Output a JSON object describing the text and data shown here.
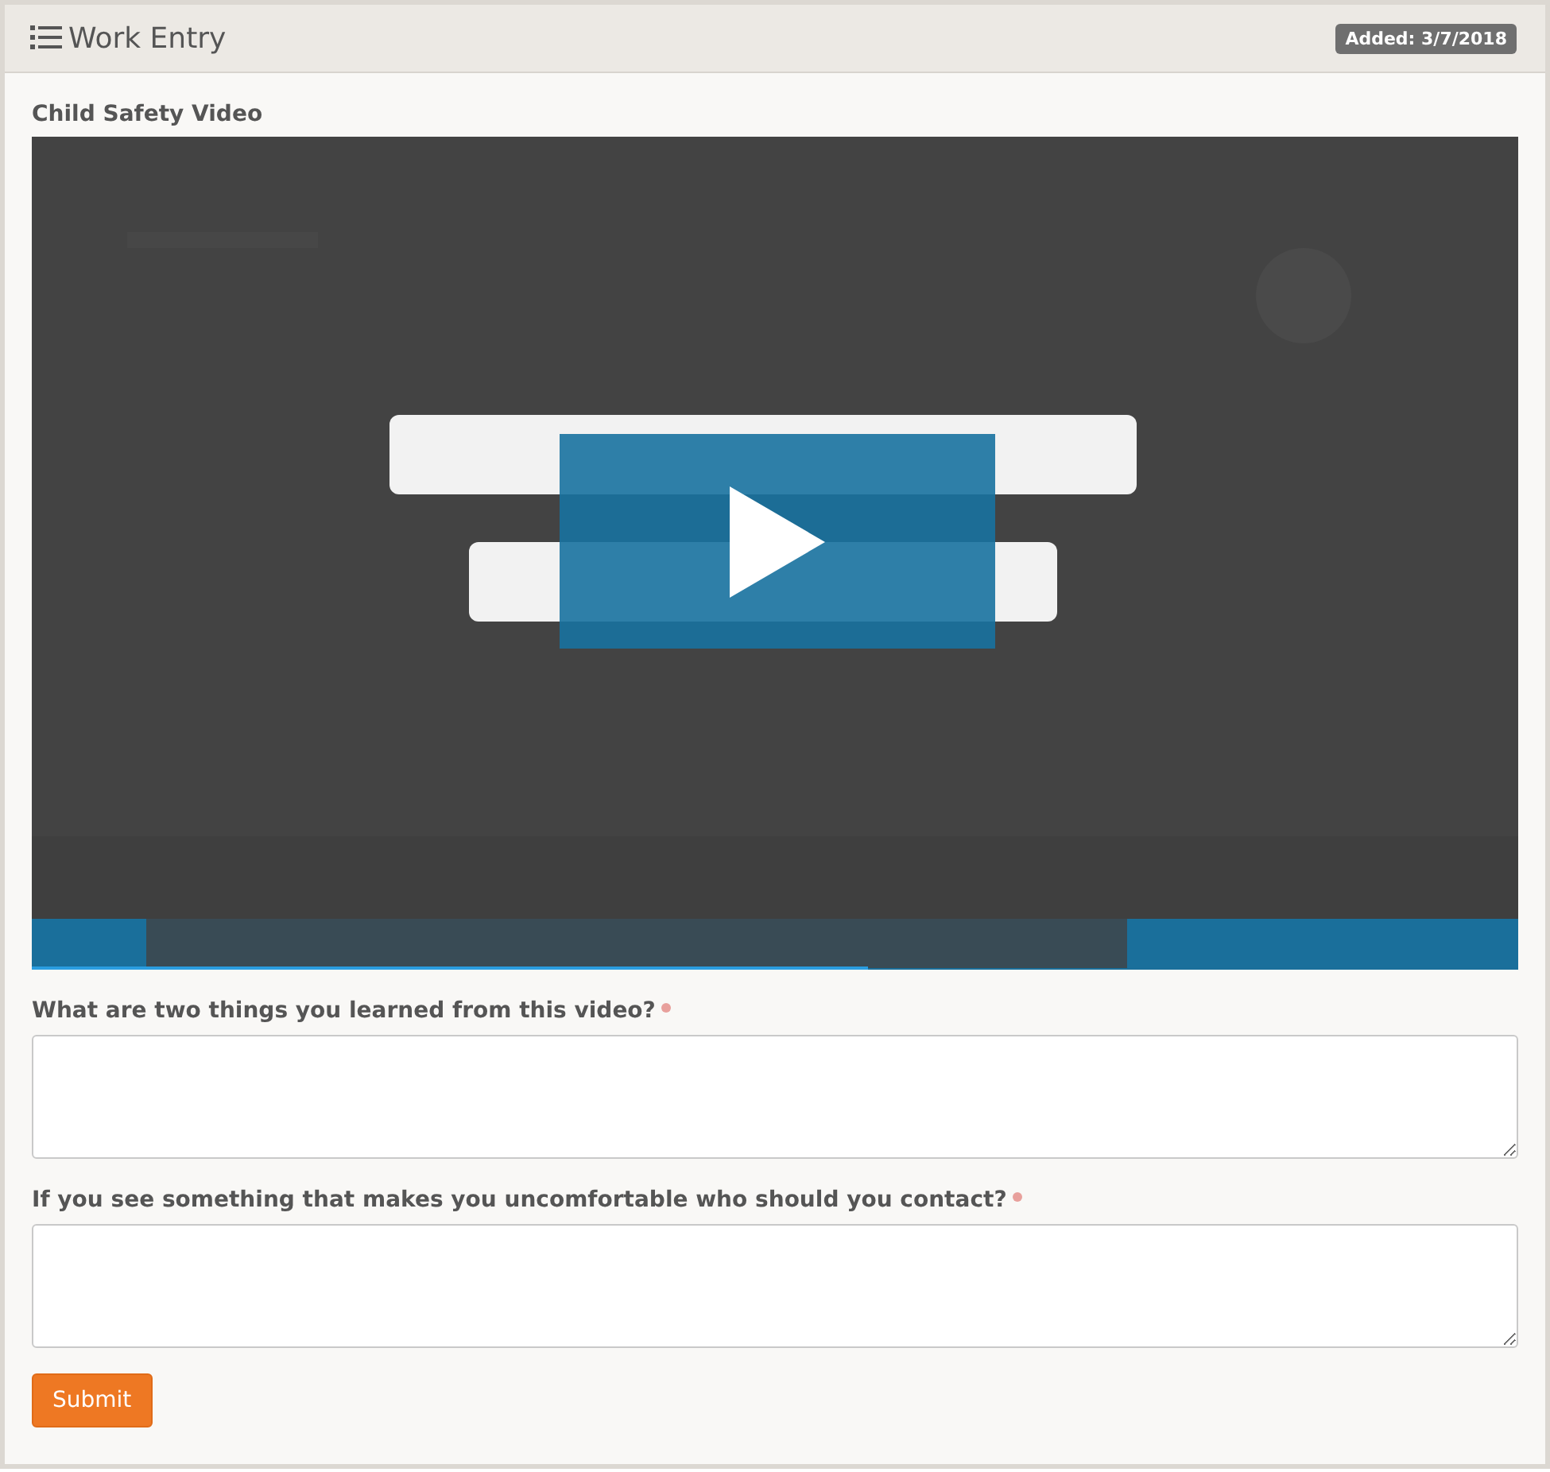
{
  "panel": {
    "title": "Work Entry",
    "badge": "Added: 3/7/2018"
  },
  "video": {
    "label": "Child Safety Video",
    "kind": "picture"
  },
  "questions": [
    {
      "label": "What are two things you learned from this video?",
      "required": true
    },
    {
      "label": "If you see something that makes you uncomfortable who should you contact?",
      "required": true
    }
  ],
  "submit": "Submit"
}
